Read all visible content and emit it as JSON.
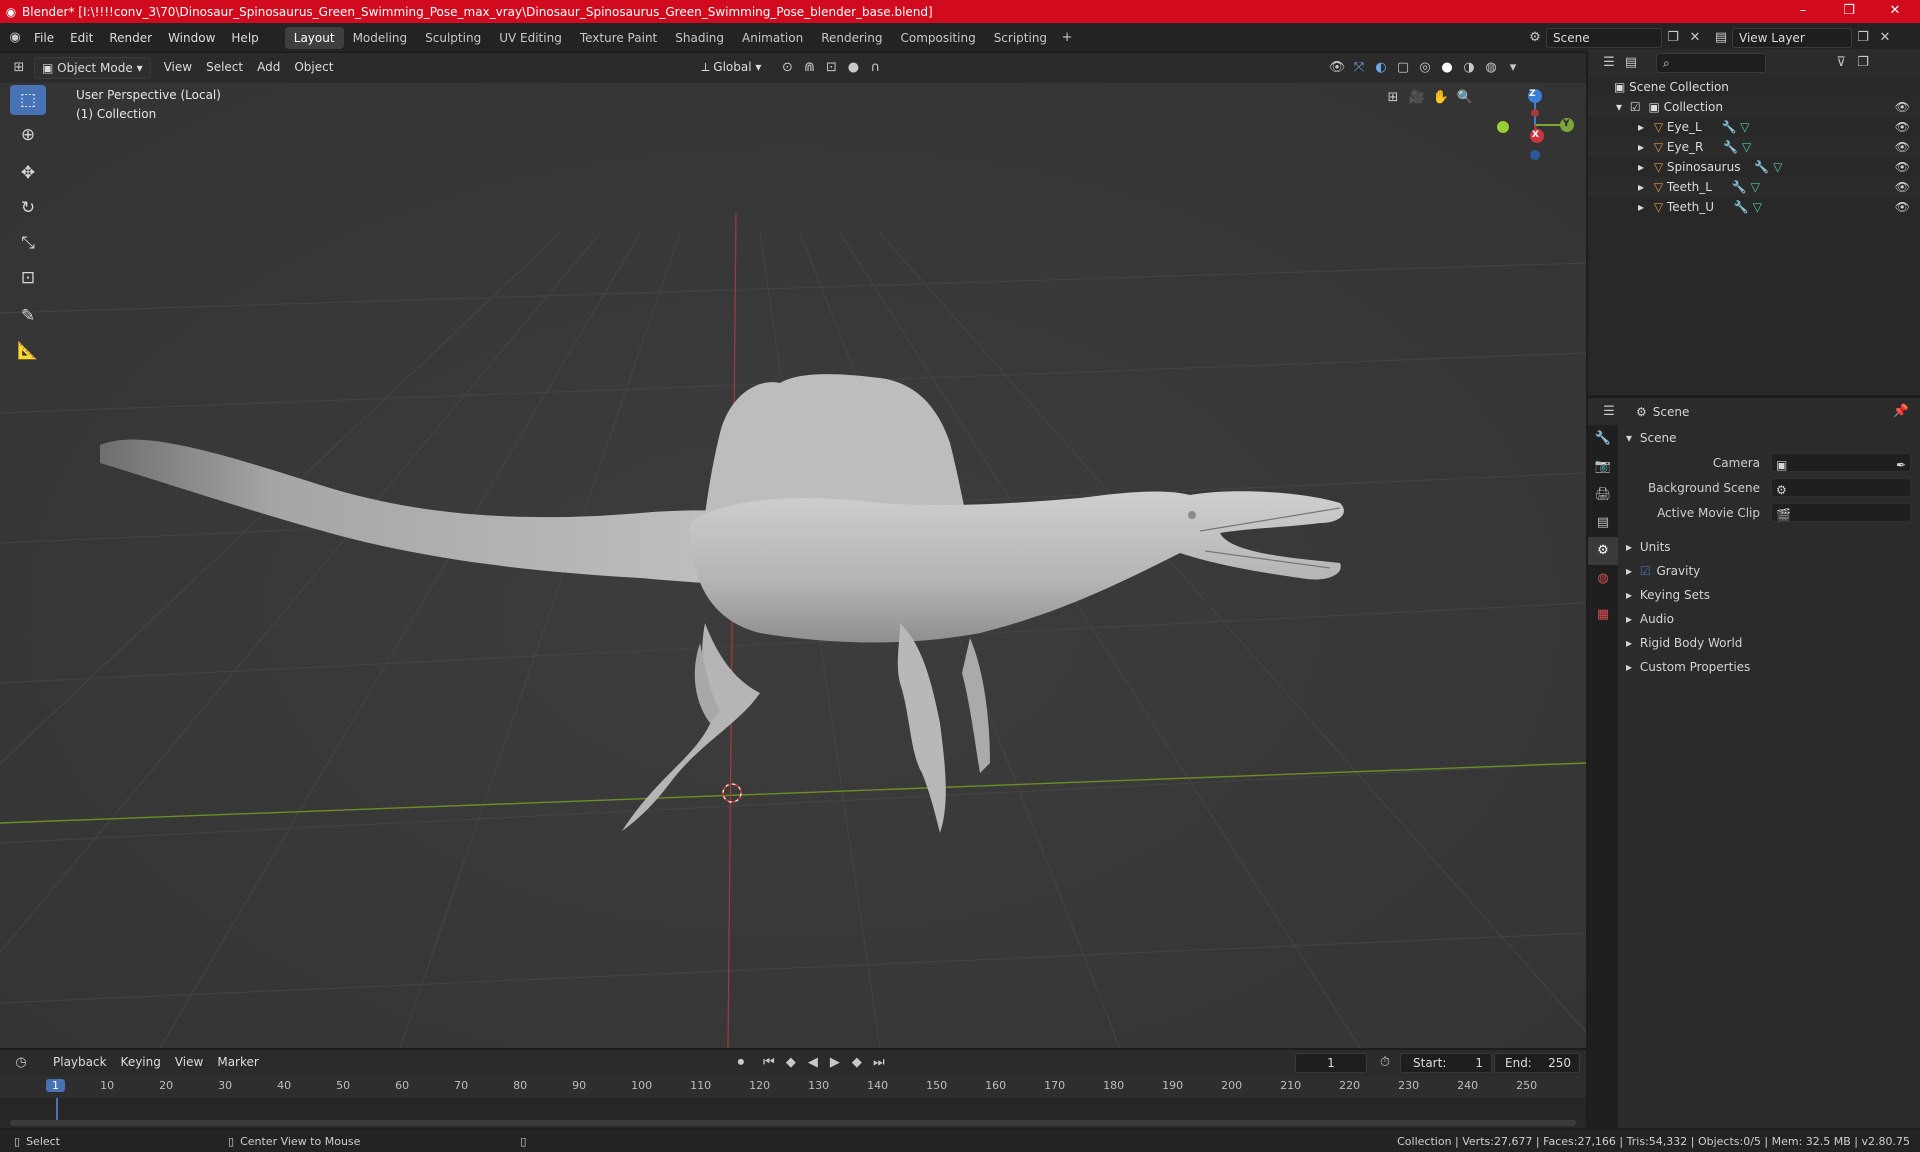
{
  "titlebar": {
    "title": "Blender* [I:\\!!!!conv_3\\70\\Dinosaur_Spinosaurus_Green_Swimming_Pose_max_vray\\Dinosaur_Spinosaurus_Green_Swimming_Pose_blender_base.blend]",
    "minimize": "–",
    "restore": "❐",
    "close": "✕"
  },
  "menu": [
    "File",
    "Edit",
    "Render",
    "Window",
    "Help"
  ],
  "workspaces": [
    "Layout",
    "Modeling",
    "Sculpting",
    "UV Editing",
    "Texture Paint",
    "Shading",
    "Animation",
    "Rendering",
    "Compositing",
    "Scripting"
  ],
  "active_workspace": "Layout",
  "scene_field": "Scene",
  "view_layer_field": "View Layer",
  "viewport_header": {
    "mode": "Object Mode",
    "menus": [
      "View",
      "Select",
      "Add",
      "Object"
    ],
    "orientation": "Global"
  },
  "viewport": {
    "perspective_label": "User Perspective (Local)",
    "collection_label": "(1) Collection",
    "gizmo": {
      "z": "Z",
      "y": "Y",
      "x": "X"
    }
  },
  "toolbar_tools": [
    "select-box",
    "cursor",
    "move",
    "rotate",
    "scale",
    "transform",
    "annotate",
    "measure"
  ],
  "outliner": {
    "root": "Scene Collection",
    "collection": "Collection",
    "objects": [
      "Eye_L",
      "Eye_R",
      "Spinosaurus",
      "Teeth_L",
      "Teeth_U"
    ]
  },
  "properties": {
    "header": "Scene",
    "panel": "Scene",
    "fields": [
      {
        "label": "Camera"
      },
      {
        "label": "Background Scene"
      },
      {
        "label": "Active Movie Clip"
      }
    ],
    "sections": [
      "Units",
      "Gravity",
      "Keying Sets",
      "Audio",
      "Rigid Body World",
      "Custom Properties"
    ],
    "gravity_checked": true
  },
  "timeline": {
    "menus": [
      "Playback",
      "Keying",
      "View",
      "Marker"
    ],
    "current_frame": "1",
    "start_label": "Start:",
    "start": "1",
    "end_label": "End:",
    "end": "250",
    "ticks": [
      "1",
      "10",
      "20",
      "30",
      "40",
      "50",
      "60",
      "70",
      "80",
      "90",
      "100",
      "110",
      "120",
      "130",
      "140",
      "150",
      "160",
      "170",
      "180",
      "190",
      "200",
      "210",
      "220",
      "230",
      "240",
      "250"
    ]
  },
  "statusbar": {
    "left_action": "Select",
    "middle_action": "Center View to Mouse",
    "stats": "Collection | Verts:27,677 | Faces:27,166 | Tris:54,332 | Objects:0/5 | Mem: 32.5 MB | v2.80.75"
  },
  "colors": {
    "titlebar": "#d10a1e",
    "accent": "#4772b3",
    "x_axis": "#c8393f",
    "y_axis": "#7ea53a",
    "z_axis": "#3b7fd6",
    "object_icon": "#e8913a",
    "modifier_icon": "#5aa6e8",
    "mesh_icon": "#4ec9a5"
  }
}
